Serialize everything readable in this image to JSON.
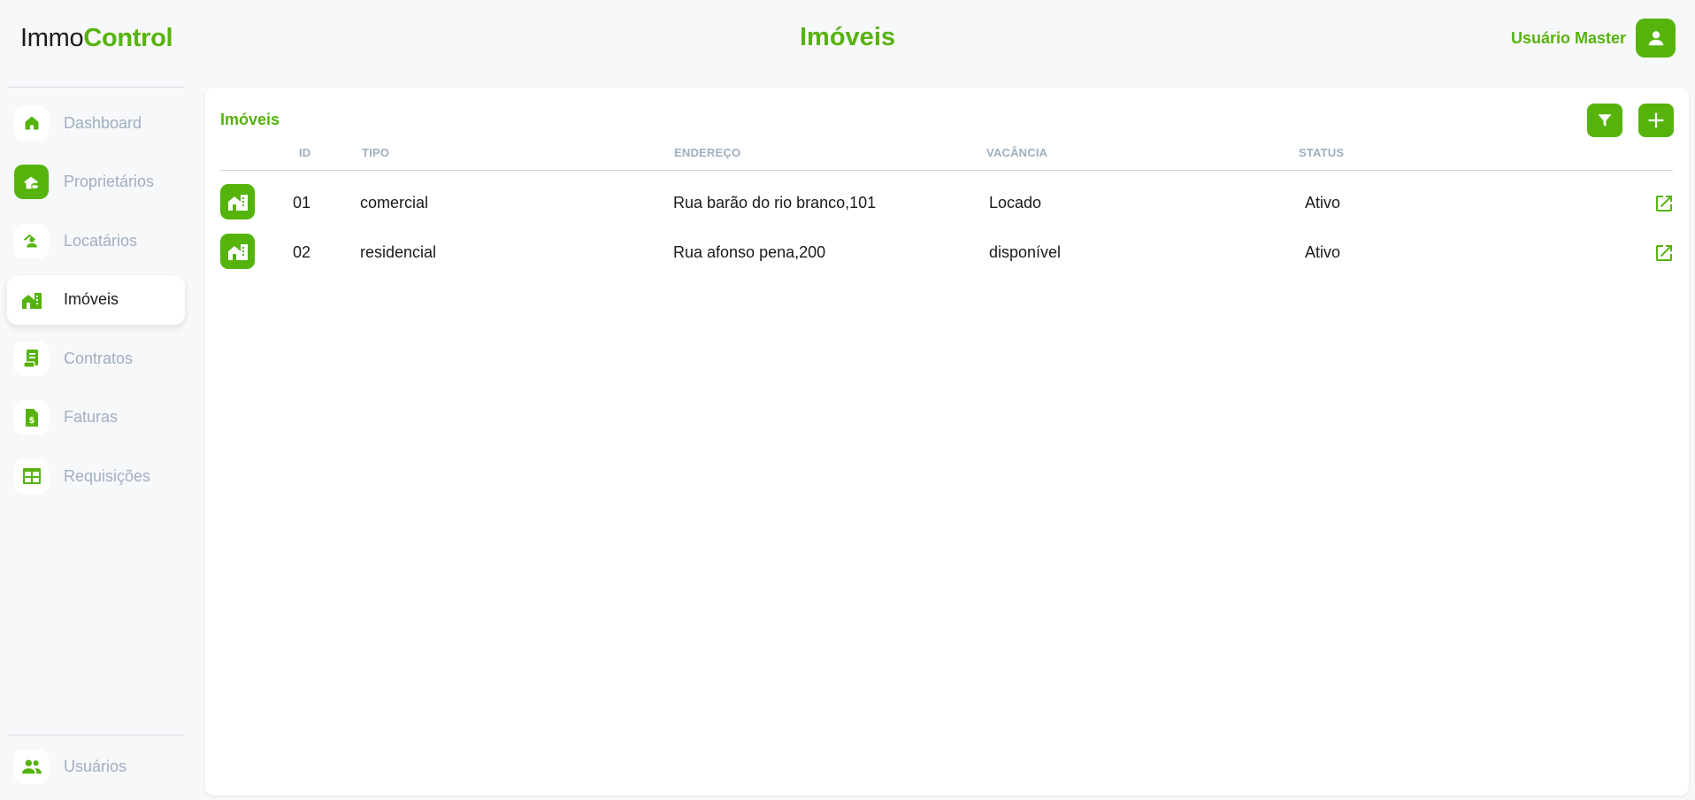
{
  "brand": {
    "part1": "Immo",
    "part2": "Control"
  },
  "header": {
    "title": "Imóveis",
    "user_name": "Usuário Master"
  },
  "sidebar": {
    "items": [
      {
        "label": "Dashboard",
        "icon": "home-icon"
      },
      {
        "label": "Proprietários",
        "icon": "owner-icon"
      },
      {
        "label": "Locatários",
        "icon": "tenant-icon"
      },
      {
        "label": "Imóveis",
        "icon": "property-icon"
      },
      {
        "label": "Contratos",
        "icon": "contract-icon"
      },
      {
        "label": "Faturas",
        "icon": "invoice-icon"
      },
      {
        "label": "Requisições",
        "icon": "requests-icon"
      }
    ],
    "bottom": {
      "label": "Usuários",
      "icon": "users-icon"
    }
  },
  "card": {
    "title": "Imóveis",
    "columns": [
      "ID",
      "TIPO",
      "ENDEREÇO",
      "VACÂNCIA",
      "STATUS"
    ],
    "rows": [
      {
        "id": "01",
        "tipo": "comercial",
        "endereco": "Rua barão do rio branco,101",
        "vacancia": "Locado",
        "status": "Ativo"
      },
      {
        "id": "02",
        "tipo": "residencial",
        "endereco": "Rua afonso pena,200",
        "vacancia": "disponível",
        "status": "Ativo"
      }
    ]
  },
  "colors": {
    "accent": "#56b30c",
    "muted": "#a0aec0",
    "background": "#f7f8fa"
  }
}
